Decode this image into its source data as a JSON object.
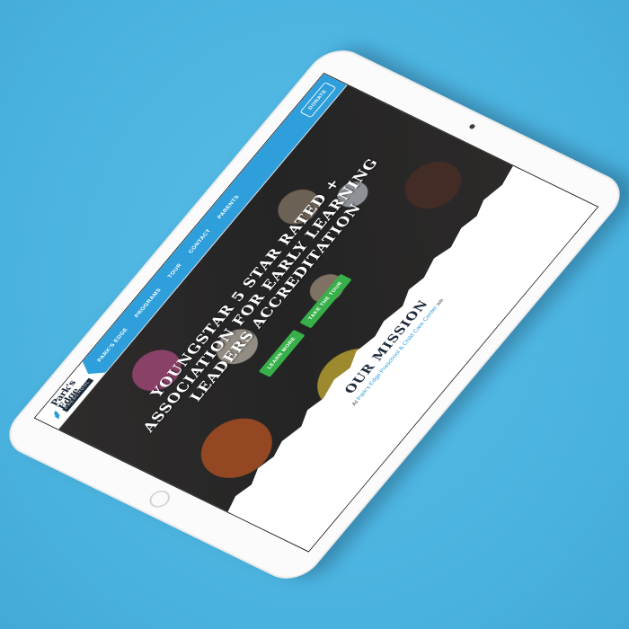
{
  "nav": {
    "logo_line1": "Park's",
    "logo_line2": "Edge",
    "logo_sub": "PRESCHOOL",
    "items": [
      {
        "label": "PARK'S EDGE"
      },
      {
        "label": "PROGRAMS"
      },
      {
        "label": "TOUR"
      },
      {
        "label": "CONTACT"
      },
      {
        "label": "PARENTS"
      }
    ],
    "donate_label": "DONATE"
  },
  "hero": {
    "title_line1": "YOUNGSTAR 5 STAR RATED +",
    "title_line2": "ASSOCIATION FOR EARLY LEARNING",
    "title_line3": "LEADERS ACCREDITATION",
    "learn_more_label": "LEARN MORE",
    "take_tour_label": "TAKE THE TOUR"
  },
  "mission": {
    "title": "OUR MISSION",
    "text_prefix": "At ",
    "text_link": "Park's Edge Preschool & Child Care Center",
    "text_suffix": " we"
  },
  "colors": {
    "background": "#4fb7e3",
    "nav_blue": "#2f9fdc",
    "button_green": "#37b04a",
    "navy": "#1d2a3a"
  },
  "icons": {
    "logo_mark": "tree-icon"
  }
}
